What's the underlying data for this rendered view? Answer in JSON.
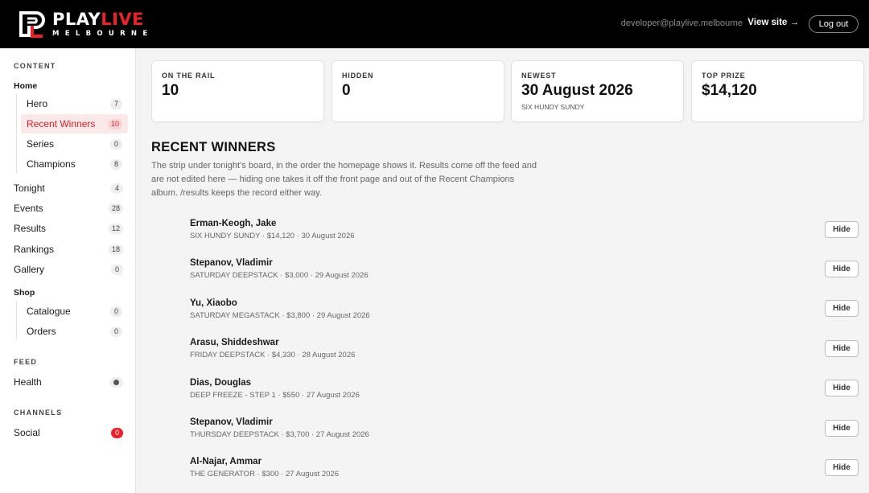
{
  "header": {
    "logo_play": "PLAY",
    "logo_live": "LIVE",
    "logo_sub": "MELBOURNE",
    "user_email": "developer@playlive.melbourne",
    "view_site": "View site →",
    "logout": "Log out"
  },
  "sidebar": {
    "content_heading": "CONTENT",
    "home": "Home",
    "home_items": [
      {
        "label": "Hero",
        "count": "7"
      },
      {
        "label": "Recent Winners",
        "count": "10"
      },
      {
        "label": "Series",
        "count": "0"
      },
      {
        "label": "Champions",
        "count": "8"
      }
    ],
    "items": [
      {
        "label": "Tonight",
        "count": "4"
      },
      {
        "label": "Events",
        "count": "28"
      },
      {
        "label": "Results",
        "count": "12"
      },
      {
        "label": "Rankings",
        "count": "18"
      },
      {
        "label": "Gallery",
        "count": "0"
      }
    ],
    "shop": "Shop",
    "shop_items": [
      {
        "label": "Catalogue",
        "count": "0"
      },
      {
        "label": "Orders",
        "count": "0"
      }
    ],
    "feed_heading": "FEED",
    "health": "Health",
    "channels_heading": "CHANNELS",
    "social": "Social",
    "social_count": "0"
  },
  "stats": [
    {
      "label": "ON THE RAIL",
      "value": "10",
      "sub": ""
    },
    {
      "label": "HIDDEN",
      "value": "0",
      "sub": ""
    },
    {
      "label": "NEWEST",
      "value": "30 August 2026",
      "sub": "SIX HUNDY SUNDY"
    },
    {
      "label": "TOP PRIZE",
      "value": "$14,120",
      "sub": ""
    }
  ],
  "main": {
    "title": "RECENT WINNERS",
    "description": "The strip under tonight’s board, in the order the homepage shows it. Results come off the feed and are not edited here — hiding one takes it off the front page and out of the Recent Champions album. /results keeps the record either way.",
    "hide_label": "Hide",
    "winners": [
      {
        "name": "Erman-Keogh, Jake",
        "meta": "SIX HUNDY SUNDY · $14,120 · 30 August 2026"
      },
      {
        "name": "Stepanov, Vladimir",
        "meta": "SATURDAY DEEPSTACK · $3,000 · 29 August 2026"
      },
      {
        "name": "Yu, Xiaobo",
        "meta": "SATURDAY MEGASTACK · $3,800 · 29 August 2026"
      },
      {
        "name": "Arasu, Shiddeshwar",
        "meta": "FRIDAY DEEPSTACK · $4,330 · 28 August 2026"
      },
      {
        "name": "Dias, Douglas",
        "meta": "DEEP FREEZE - STEP 1 · $550 · 27 August 2026"
      },
      {
        "name": "Stepanov, Vladimir",
        "meta": "THURSDAY DEEPSTACK · $3,700 · 27 August 2026"
      },
      {
        "name": "Al-Najar, Ammar",
        "meta": "THE GENERATOR · $300 · 27 August 2026"
      }
    ]
  },
  "colors": {
    "brand_red": "#e8212b",
    "header_bg": "#000000",
    "active_bg": "#fbe9ea"
  }
}
